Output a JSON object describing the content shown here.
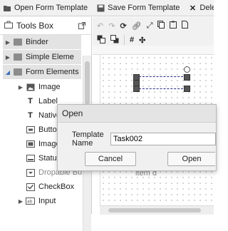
{
  "toolbar": {
    "open_template": "Open Form Template",
    "save_template": "Save Form Template",
    "delete_template": "Delete Fo"
  },
  "tools_box": {
    "title": "Tools Box",
    "categories": [
      {
        "label": "Binder",
        "expanded": false
      },
      {
        "label": "Simple Eleme",
        "expanded": false
      },
      {
        "label": "Form Elements",
        "expanded": true
      }
    ],
    "items": [
      {
        "label": "Image",
        "icon": "image-icon",
        "has_arrow": true
      },
      {
        "label": "Label",
        "icon": "text-icon",
        "has_arrow": false
      },
      {
        "label": "Native E",
        "icon": "text-icon",
        "has_arrow": false
      },
      {
        "label": "Button",
        "icon": "button-icon",
        "has_arrow": false
      },
      {
        "label": "Image B",
        "icon": "image-button-icon",
        "has_arrow": false
      },
      {
        "label": "Status B",
        "icon": "status-icon",
        "has_arrow": false
      },
      {
        "label": "Dropable Butto",
        "icon": "dropdown-icon",
        "has_arrow": false
      },
      {
        "label": "CheckBox",
        "icon": "checkbox-icon",
        "has_arrow": false
      },
      {
        "label": "Input",
        "icon": "input-icon",
        "has_arrow": true
      }
    ]
  },
  "canvas": {
    "item_text": "item d"
  },
  "dialog": {
    "title": "Open",
    "field_label": "Template Name",
    "field_value": "Task002",
    "cancel_label": "Cancel",
    "open_label": "Open"
  }
}
